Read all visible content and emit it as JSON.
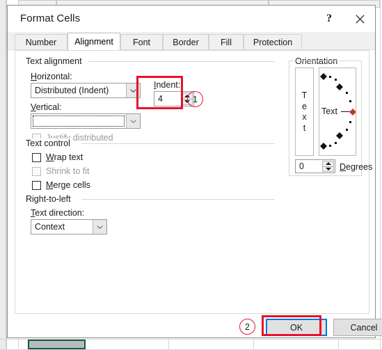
{
  "window": {
    "title": "Format Cells",
    "help_icon": "question-mark-icon",
    "close_icon": "close-icon"
  },
  "tabs": [
    {
      "label": "Number",
      "active": false
    },
    {
      "label": "Alignment",
      "active": true
    },
    {
      "label": "Font",
      "active": false
    },
    {
      "label": "Border",
      "active": false
    },
    {
      "label": "Fill",
      "active": false
    },
    {
      "label": "Protection",
      "active": false
    }
  ],
  "text_alignment": {
    "group_title": "Text alignment",
    "horizontal": {
      "label": "Horizontal:",
      "accel": "H",
      "value": "Distributed (Indent)",
      "icon": "chevron-down-icon"
    },
    "vertical": {
      "label": "Vertical:",
      "accel": "V",
      "value": "",
      "icon": "chevron-down-icon",
      "focused": true
    },
    "indent": {
      "label": "Indent:",
      "accel": "I",
      "value": "4",
      "up_icon": "spinner-up-icon",
      "down_icon": "spinner-down-icon"
    },
    "justify_distributed": {
      "label": "Justify distributed",
      "checked": false,
      "disabled": true
    }
  },
  "text_control": {
    "group_title": "Text control",
    "items": [
      {
        "label": "Wrap text",
        "accel": "W",
        "checked": false,
        "disabled": false
      },
      {
        "label": "Shrink to fit",
        "accel": "S",
        "checked": false,
        "disabled": true
      },
      {
        "label": "Merge cells",
        "accel": "M",
        "checked": false,
        "disabled": false
      }
    ]
  },
  "right_to_left": {
    "group_title": "Right-to-left",
    "text_direction": {
      "label": "Text direction:",
      "accel": "T",
      "value": "Context",
      "icon": "chevron-down-icon"
    }
  },
  "orientation": {
    "group_title": "Orientation",
    "vertical_text_letters": [
      "T",
      "e",
      "x",
      "t"
    ],
    "dial_label": "Text",
    "degrees": {
      "value": "0",
      "label": "Degrees",
      "accel": "D",
      "up_icon": "spinner-up-icon",
      "down_icon": "spinner-down-icon"
    }
  },
  "buttons": {
    "ok": "OK",
    "cancel": "Cancel"
  },
  "annotations": [
    {
      "number": "1",
      "target": "indent-field"
    },
    {
      "number": "2",
      "target": "ok-button"
    }
  ],
  "colors": {
    "annotation_red": "#e8112d",
    "default_button_blue": "#0078d7",
    "dial_handle_red": "#c0392b",
    "cell_orange": "#f2c5a8"
  }
}
